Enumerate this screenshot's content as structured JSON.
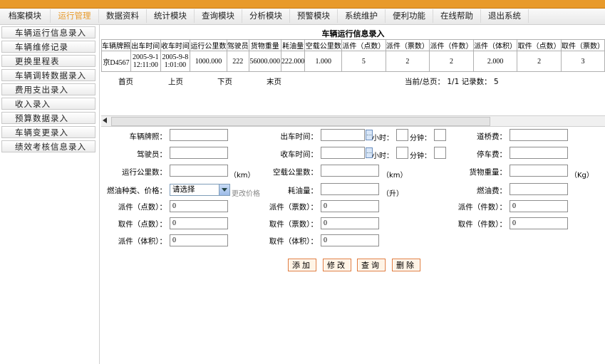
{
  "menu": [
    "档案模块",
    "运行管理",
    "数据资料",
    "统计模块",
    "查询模块",
    "分析模块",
    "预警模块",
    "系统维护",
    "便利功能",
    "在线帮助",
    "退出系统"
  ],
  "sidebar": [
    "车辆运行信息录入",
    "车辆维修记录",
    "更换里程表",
    "车辆调转数据录入",
    "费用支出录入",
    "收入录入",
    "预算数据录入",
    "车辆变更录入",
    "绩效考核信息录入"
  ],
  "table": {
    "title": "车辆运行信息录入",
    "headers": [
      "车辆牌照",
      "出车时间",
      "收车时间",
      "运行公里数",
      "驾驶员",
      "货物重量",
      "耗油量",
      "空载公里数",
      "派件（点数）",
      "派件（票数）",
      "派件（件数）",
      "派件（体积）",
      "取件（点数）",
      "取件（票数）"
    ],
    "row": [
      "京D4567",
      "2005-9-1 12:11:00",
      "2005-9-8 1:01:00",
      "1000.000",
      "222",
      "56000.000",
      "222.000",
      "1.000",
      "5",
      "2",
      "2",
      "2.000",
      "2",
      "3"
    ]
  },
  "pager": {
    "first": "首页",
    "prev": "上页",
    "next": "下页",
    "last": "末页",
    "info": "当前/总页： 1/1 记录数： 5"
  },
  "form": {
    "plate_label": "车辆牌照：",
    "depart_label": "出车时间：",
    "toll_label": "道桥费：",
    "driver_label": "驾驶员：",
    "return_label": "收车时间：",
    "parking_label": "停车费：",
    "distance_label": "运行公里数：",
    "empty_label": "空载公里数：",
    "weight_label": "货物重量：",
    "fuel_type_label": "燃油种类、价格：",
    "fuel_use_label": "耗油量：",
    "fuel_cost_label": "燃油费：",
    "send_points_label": "派件（点数）：",
    "send_tickets_label": "派件（票数）：",
    "send_pieces_label": "派件（件数）：",
    "pick_points_label": "取件（点数）：",
    "pick_tickets_label": "取件（票数）：",
    "pick_pieces_label": "取件（件数）：",
    "send_volume_label": "派件（体积）：",
    "pick_volume_label": "取件（体积）：",
    "hour_label": "小时：",
    "minute_label": "分钟：",
    "km_unit": "（km）",
    "kg_unit": "（Kg）",
    "liter_unit": "（升）",
    "select_value": "请选择",
    "change_price": "更改价格",
    "zero": "0",
    "cal_glyph": "…"
  },
  "buttons": {
    "add": "添加",
    "edit": "修改",
    "query": "查询",
    "delete": "删除"
  }
}
